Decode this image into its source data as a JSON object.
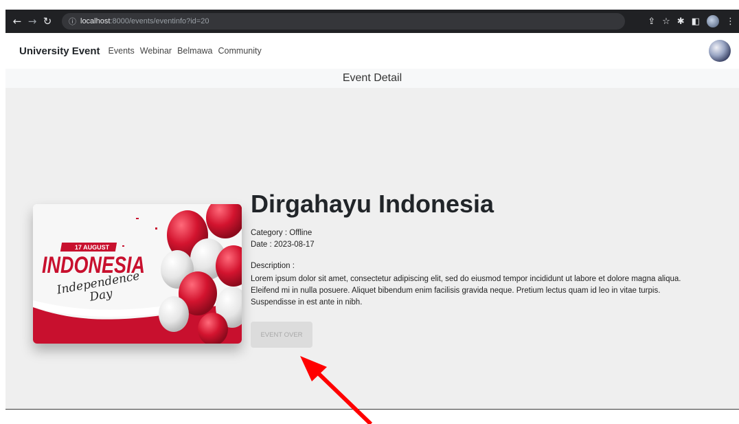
{
  "browser": {
    "url_host": "localhost",
    "url_rest": ":8000/events/eventinfo?id=20",
    "icons": [
      "back-arrow-icon",
      "forward-arrow-icon",
      "reload-icon",
      "info-icon",
      "share-icon",
      "star-icon",
      "extensions-icon",
      "sidepanel-icon",
      "profile-icon",
      "menu-icon"
    ]
  },
  "navbar": {
    "brand": "University Event",
    "links": [
      "Events",
      "Webinar",
      "Belmawa",
      "Community"
    ]
  },
  "subheader": {
    "title": "Event Detail"
  },
  "event": {
    "title": "Dirgahayu Indonesia",
    "category": "Category : Offline",
    "date": "Date : 2023-08-17",
    "description_label": "Description :",
    "description": "Lorem ipsum dolor sit amet, consectetur adipiscing elit, sed do eiusmod tempor incididunt ut labore et dolore magna aliqua. Eleifend mi in nulla posuere. Aliquet bibendum enim facilisis gravida neque. Pretium lectus quam id leo in vitae turpis. Suspendisse in est ante in nibh.",
    "button_label": "EVENT OVER",
    "banner": {
      "date_ribbon": "17 AUGUST",
      "headline": "INDONESIA",
      "script_line1": "Independence",
      "script_line2": "Day"
    }
  },
  "colors": {
    "page_bg": "#efefef",
    "banner_red": "#c8102e",
    "annotation_arrow": "#ff0000",
    "button_disabled_bg": "#dcdcdc"
  }
}
